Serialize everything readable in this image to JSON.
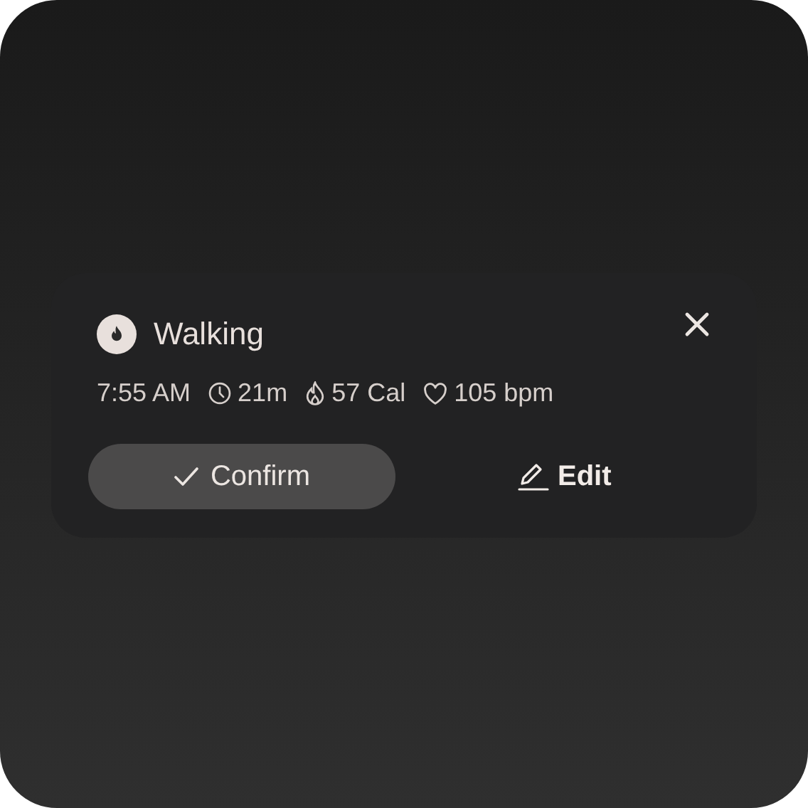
{
  "activity": {
    "title": "Walking"
  },
  "stats": [
    {
      "kind": "time",
      "text": "7:55 AM"
    },
    {
      "kind": "duration",
      "text": "21m"
    },
    {
      "kind": "calories",
      "text": "57 Cal"
    },
    {
      "kind": "heart",
      "text": "105 bpm"
    }
  ],
  "buttons": [
    {
      "kind": "confirm",
      "label": "Confirm"
    },
    {
      "kind": "edit",
      "label": "Edit"
    }
  ]
}
